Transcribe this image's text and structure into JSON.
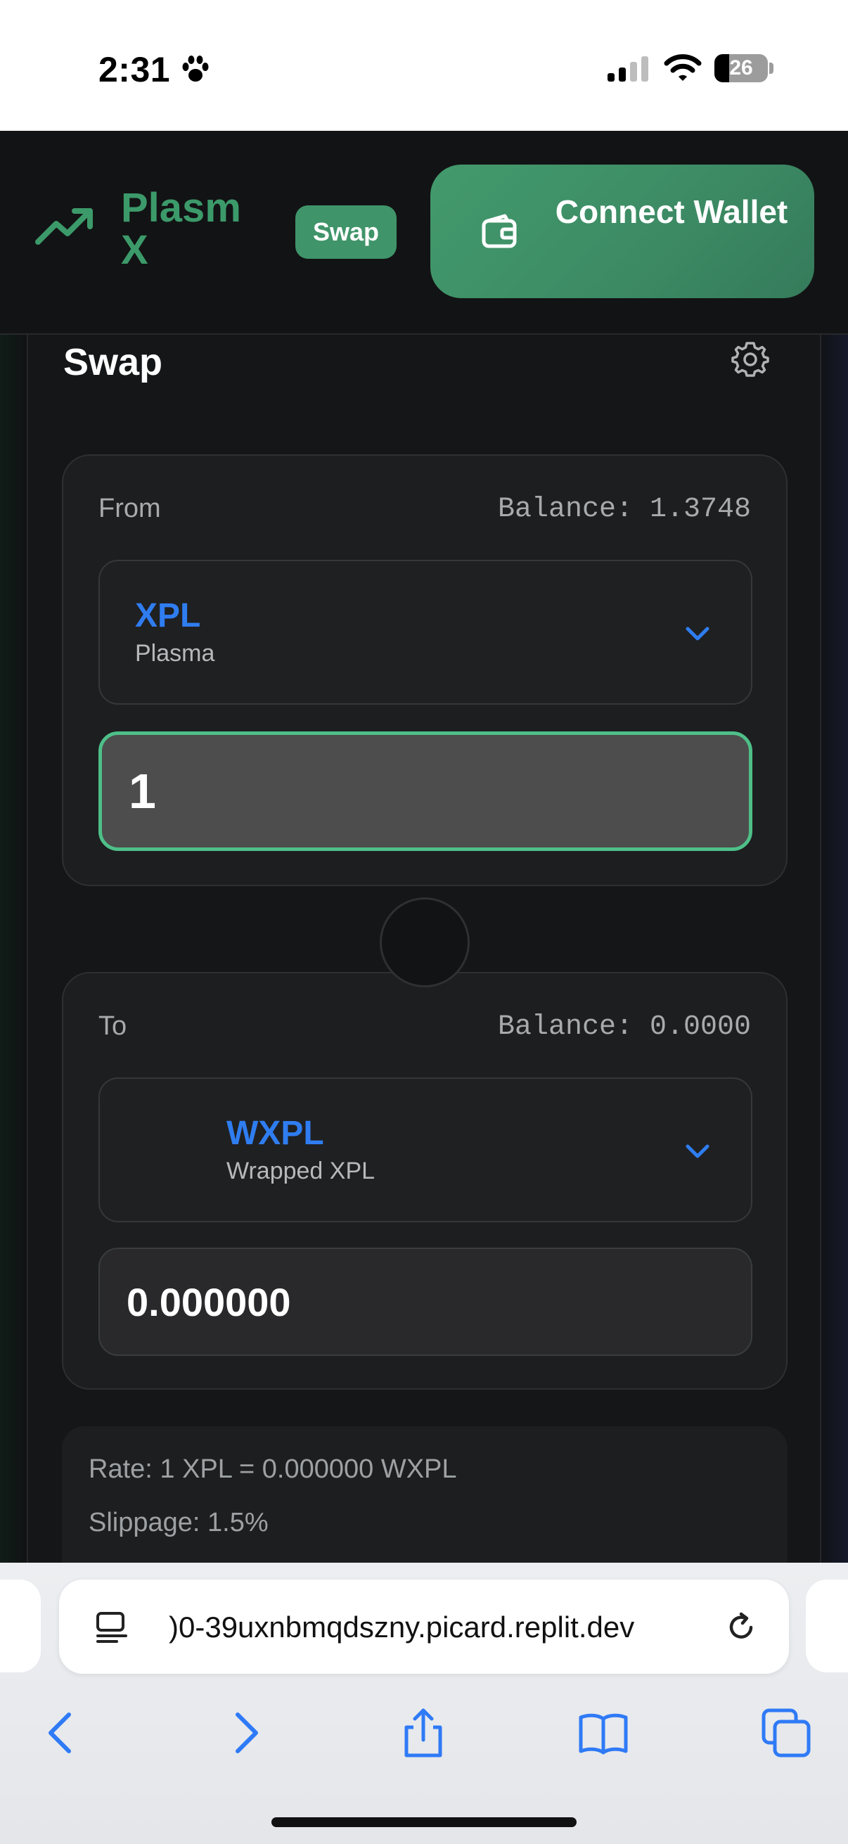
{
  "status_bar": {
    "time": "2:31",
    "battery": "26",
    "icons": [
      "paw-icon",
      "cellular-signal-icon",
      "wifi-icon",
      "battery-icon"
    ]
  },
  "header": {
    "brand": "Plasm X",
    "brand_icon": "trending-up-icon",
    "nav_swap_label": "Swap",
    "connect_wallet_label": "Connect Wallet",
    "connect_wallet_icon": "wallet-icon"
  },
  "swap": {
    "title": "Swap",
    "settings_icon": "gear-icon",
    "from": {
      "label": "From",
      "balance": "Balance: 1.3748",
      "token_symbol": "XPL",
      "token_name": "Plasma",
      "amount": "1"
    },
    "to": {
      "label": "To",
      "balance": "Balance: 0.0000",
      "token_symbol": "WXPL",
      "token_name": "Wrapped XPL",
      "amount": "0.000000"
    },
    "rate": "Rate: 1 XPL = 0.000000 WXPL",
    "slippage": "Slippage: 1.5%"
  },
  "browser": {
    "url": ")0-39uxnbmqdszny.picard.replit.dev",
    "toolbar": [
      "back-icon",
      "forward-icon",
      "share-icon",
      "bookmarks-icon",
      "tabs-icon"
    ]
  },
  "colors": {
    "brand_green": "#3c9a6a",
    "token_blue": "#2f7df0",
    "input_focus_border": "#4ebf88",
    "browser_blue": "#2f7af6"
  }
}
